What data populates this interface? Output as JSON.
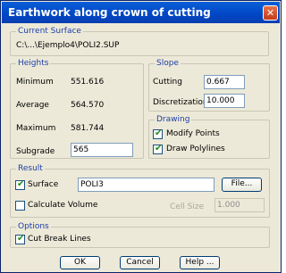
{
  "window": {
    "title": "Earthwork along crown of cutting",
    "close_glyph": "✕"
  },
  "current_surface": {
    "legend": "Current Surface",
    "path": "C:\\...\\Ejemplo4\\POLI2.SUP"
  },
  "heights": {
    "legend": "Heights",
    "minimum_label": "Minimum",
    "minimum_value": "551.616",
    "average_label": "Average",
    "average_value": "564.570",
    "maximum_label": "Maximum",
    "maximum_value": "581.744",
    "subgrade_label": "Subgrade",
    "subgrade_value": "565"
  },
  "slope": {
    "legend": "Slope",
    "cutting_label": "Cutting",
    "cutting_value": "0.667",
    "discretization_label": "Discretization",
    "discretization_value": "10.000"
  },
  "drawing": {
    "legend": "Drawing",
    "modify_points_label": "Modify Points",
    "modify_points_checked": true,
    "draw_polylines_label": "Draw Polylines",
    "draw_polylines_checked": true
  },
  "result": {
    "legend": "Result",
    "surface_label": "Surface",
    "surface_checked": true,
    "surface_value": "POLI3",
    "file_button": "File...",
    "calculate_volume_label": "Calculate Volume",
    "calculate_volume_checked": false,
    "cell_size_label": "Cell Size",
    "cell_size_value": "1.000"
  },
  "options": {
    "legend": "Options",
    "cut_break_lines_label": "Cut Break Lines",
    "cut_break_lines_checked": true
  },
  "buttons": {
    "ok": "OK",
    "cancel": "Cancel",
    "help": "Help ..."
  },
  "colors": {
    "title_bar": "#0046c4",
    "dialog_bg": "#ece9d8",
    "legend_text": "#1c3ea8",
    "check_mark": "#1e8c1e"
  }
}
